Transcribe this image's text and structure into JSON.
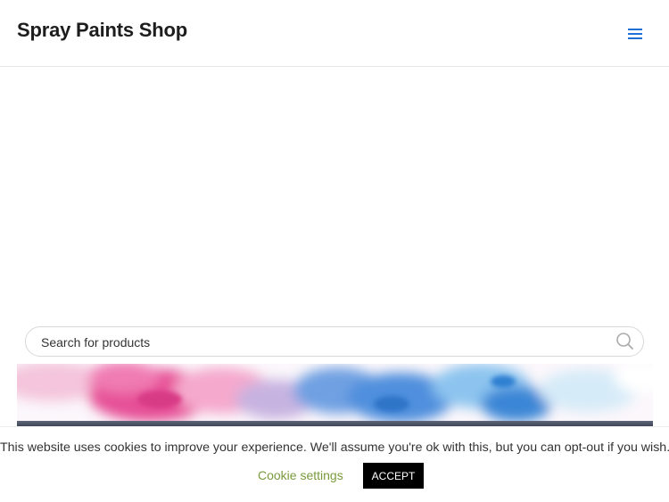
{
  "header": {
    "site_title": "Spray Paints Shop",
    "menu_icon": "hamburger-menu-icon",
    "accent_color": "#1d6fd3"
  },
  "search": {
    "placeholder": "Search for products",
    "value": "",
    "icon": "search-icon"
  },
  "banner": {
    "description_colors": [
      "#e8589d",
      "#58a8e8",
      "#3f4656"
    ]
  },
  "cookie_notice": {
    "message": "This website uses cookies to improve your experience. We'll assume you're ok with this, but you can opt-out if you wish.",
    "settings_label": "Cookie settings",
    "accept_label": "ACCEPT",
    "settings_color": "#7a9a3d"
  }
}
